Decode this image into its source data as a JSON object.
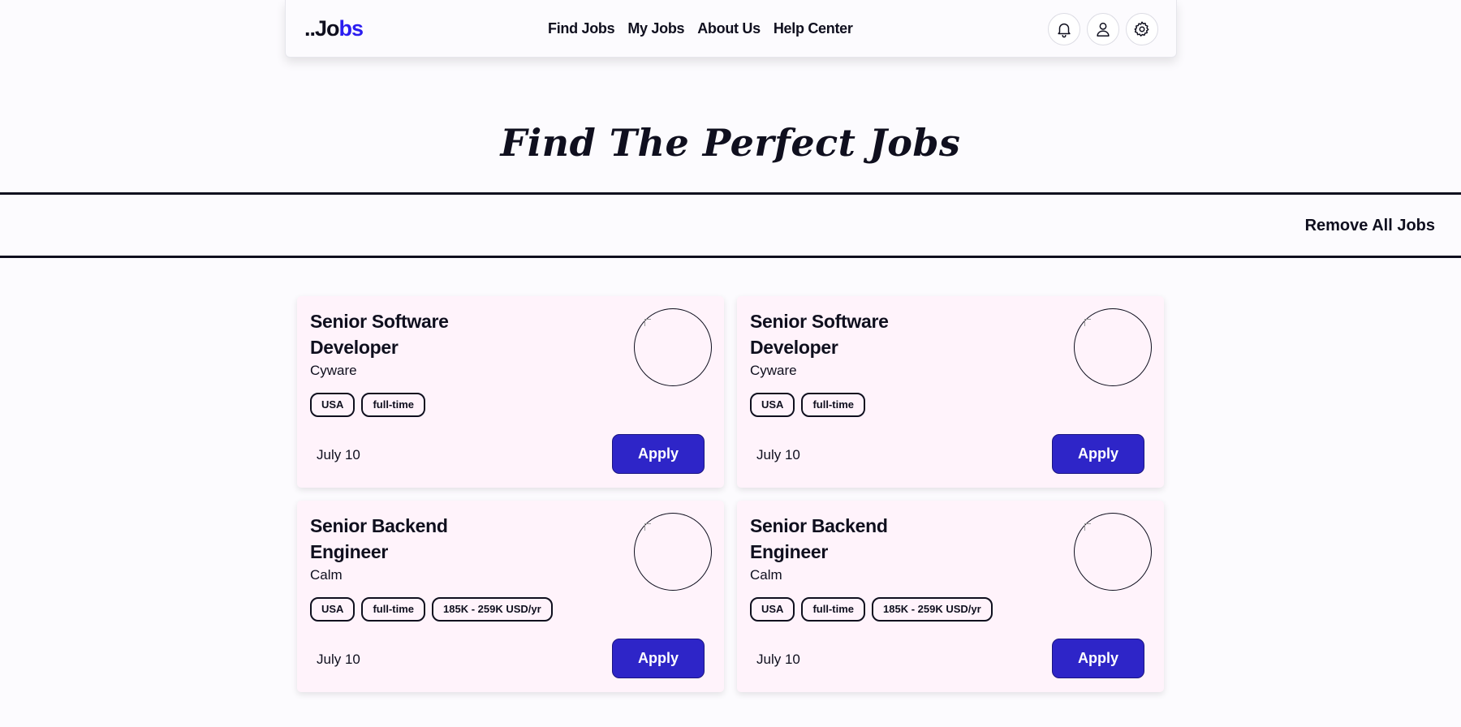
{
  "header": {
    "logo_dark": "..Jo",
    "logo_blue": "bs",
    "nav": [
      "Find Jobs",
      "My Jobs",
      "About Us",
      "Help Center"
    ],
    "icons": [
      "bell-icon",
      "user-icon",
      "gear-icon"
    ]
  },
  "hero": {
    "title": "Find The Perfect Jobs"
  },
  "actions": {
    "remove_all_label": "Remove All Jobs"
  },
  "jobs": [
    {
      "title": "Senior Software Developer",
      "company": "Cyware",
      "tags": [
        "USA",
        "full-time"
      ],
      "date": "July 10",
      "apply_label": "Apply"
    },
    {
      "title": "Senior Software Developer",
      "company": "Cyware",
      "tags": [
        "USA",
        "full-time"
      ],
      "date": "July 10",
      "apply_label": "Apply"
    },
    {
      "title": "Senior Backend Engineer",
      "company": "Calm",
      "tags": [
        "USA",
        "full-time",
        "185K - 259K USD/yr"
      ],
      "date": "July 10",
      "apply_label": "Apply"
    },
    {
      "title": "Senior Backend Engineer",
      "company": "Calm",
      "tags": [
        "USA",
        "full-time",
        "185K - 259K USD/yr"
      ],
      "date": "July 10",
      "apply_label": "Apply"
    }
  ],
  "colors": {
    "accent": "#2e25c8",
    "logo_blue": "#2b1df0",
    "card_bg": "#fff3fb",
    "page_bg": "#fcfbfe",
    "text": "#0f0f1e"
  }
}
